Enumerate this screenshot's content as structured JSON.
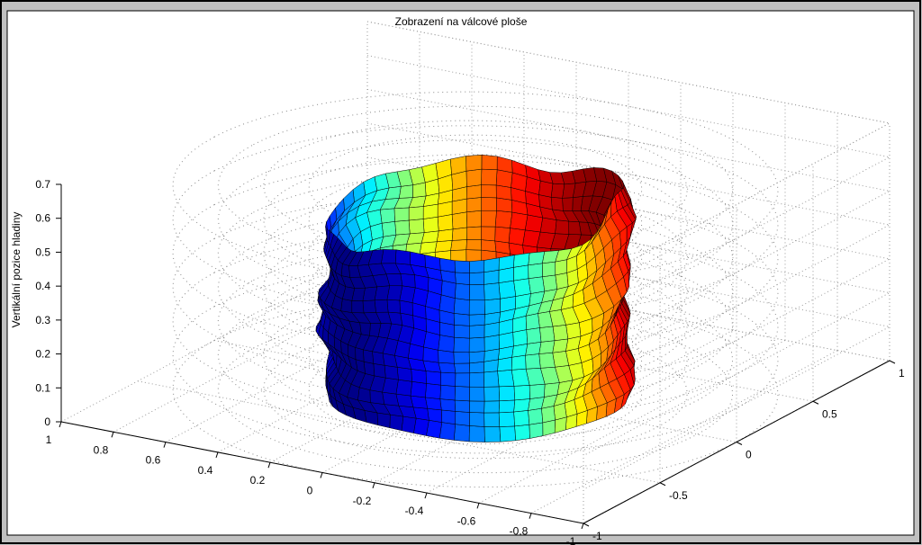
{
  "chart_data": {
    "type": "surface3d",
    "title": "Zobrazení na válcové ploše",
    "zlabel": "Vertikální pozice hladiny",
    "xlabel": "",
    "ylabel": "",
    "x_ticks": [
      "1",
      "0.8",
      "0.6",
      "0.4",
      "0.2",
      "0",
      "-0.2",
      "-0.4",
      "-0.6",
      "-0.8",
      "-1"
    ],
    "y_ticks": [
      "-1",
      "-0.5",
      "0",
      "0.5",
      "1"
    ],
    "z_ticks": [
      "0",
      "0.1",
      "0.2",
      "0.3",
      "0.4",
      "0.5",
      "0.6",
      "0.7"
    ],
    "xlim": [
      -1,
      1
    ],
    "ylim": [
      -1,
      1
    ],
    "zlim": [
      0,
      0.7
    ],
    "grid": true,
    "colormap": "jet",
    "surface": {
      "shape": "cylinder",
      "radius": 0.5,
      "z_base": 0,
      "z_top_range": [
        0.45,
        0.62
      ]
    },
    "reference_cylinders": {
      "radii": [
        0.55,
        0.7,
        0.85,
        1.0
      ],
      "style": "dotted"
    }
  },
  "colors": {
    "figure_bg": "#c0c0c0",
    "axes_bg": "#ffffff",
    "grid": "#9a9a9a",
    "edge": "#000000"
  }
}
